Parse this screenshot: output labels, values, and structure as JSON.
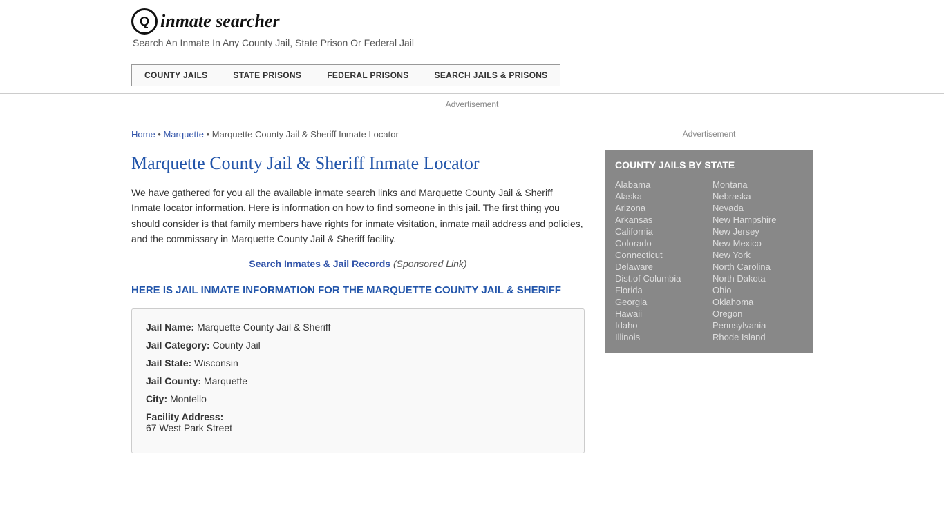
{
  "header": {
    "logo_letter": "Q",
    "logo_text": "inmate searcher",
    "tagline": "Search An Inmate In Any County Jail, State Prison Or Federal Jail"
  },
  "nav": {
    "items": [
      {
        "label": "COUNTY JAILS",
        "id": "county-jails"
      },
      {
        "label": "STATE PRISONS",
        "id": "state-prisons"
      },
      {
        "label": "FEDERAL PRISONS",
        "id": "federal-prisons"
      },
      {
        "label": "SEARCH JAILS & PRISONS",
        "id": "search-jails"
      }
    ]
  },
  "ad_label": "Advertisement",
  "breadcrumb": {
    "home": "Home",
    "marquette": "Marquette",
    "current": "Marquette County Jail & Sheriff Inmate Locator"
  },
  "page_title": "Marquette County Jail & Sheriff Inmate Locator",
  "description": "We have gathered for you all the available inmate search links and Marquette County Jail & Sheriff Inmate locator information. Here is information on how to find someone in this jail. The first thing you should consider is that family members have rights for inmate visitation, inmate mail address and policies, and the commissary in Marquette County Jail & Sheriff facility.",
  "search_link": {
    "text": "Search Inmates & Jail Records",
    "sponsored": "(Sponsored Link)"
  },
  "section_heading": "HERE IS JAIL INMATE INFORMATION FOR THE MARQUETTE COUNTY JAIL & SHERIFF",
  "jail_info": {
    "name_label": "Jail Name:",
    "name_value": "Marquette County Jail & Sheriff",
    "category_label": "Jail Category:",
    "category_value": "County Jail",
    "state_label": "Jail State:",
    "state_value": "Wisconsin",
    "county_label": "Jail County:",
    "county_value": "Marquette",
    "city_label": "City:",
    "city_value": "Montello",
    "address_label": "Facility Address:",
    "address_value": "67 West Park Street"
  },
  "sidebar": {
    "ad_label": "Advertisement",
    "county_jails_title": "COUNTY JAILS BY STATE",
    "states_left": [
      "Alabama",
      "Alaska",
      "Arizona",
      "Arkansas",
      "California",
      "Colorado",
      "Connecticut",
      "Delaware",
      "Dist.of Columbia",
      "Florida",
      "Georgia",
      "Hawaii",
      "Idaho",
      "Illinois"
    ],
    "states_right": [
      "Montana",
      "Nebraska",
      "Nevada",
      "New Hampshire",
      "New Jersey",
      "New Mexico",
      "New York",
      "North Carolina",
      "North Dakota",
      "Ohio",
      "Oklahoma",
      "Oregon",
      "Pennsylvania",
      "Rhode Island"
    ]
  }
}
